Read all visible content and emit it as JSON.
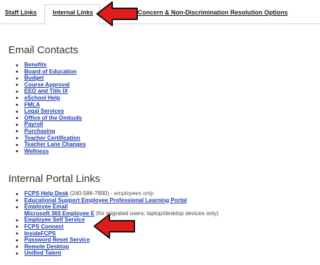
{
  "tabs": {
    "staff_links": "Staff Links",
    "internal_links": "Internal Links",
    "concern": "Concern & Non-Discrimination Resolution Options"
  },
  "email_contacts": {
    "heading": "Email Contacts",
    "items": [
      "Benefits",
      "Board of Education",
      "Budget",
      "Course Approval",
      "EEO and Title IX",
      "eSchool Help",
      "FMLA",
      "Legal Services",
      "Office of the Ombuds",
      "Payroll",
      "Purchasing",
      "Teacher Certification",
      "Teacher Lane Changes",
      "Wellness"
    ]
  },
  "internal_portal": {
    "heading": "Internal Portal Links",
    "items": [
      {
        "label": "FCPS Help Desk",
        "note": "(240-586-7890)",
        "note_italic": " - employees only"
      },
      {
        "label": "Educational Support Employee Professional Learning Portal"
      },
      {
        "label": "Employee Email"
      },
      {
        "label": "Microsoft 365 Employee E",
        "note": "(for migrated users: laptop/desktop devices only)",
        "no_bullet": true
      },
      {
        "label": "Employee Self Service"
      },
      {
        "label": "FCPS Connect"
      },
      {
        "label": "InsideFCPS"
      },
      {
        "label": "Password Reset Service"
      },
      {
        "label": "Remote Desktop"
      },
      {
        "label": "Unified Talent"
      }
    ]
  },
  "colors": {
    "link": "#1f3fb0",
    "arrow": "#e01b1b"
  }
}
